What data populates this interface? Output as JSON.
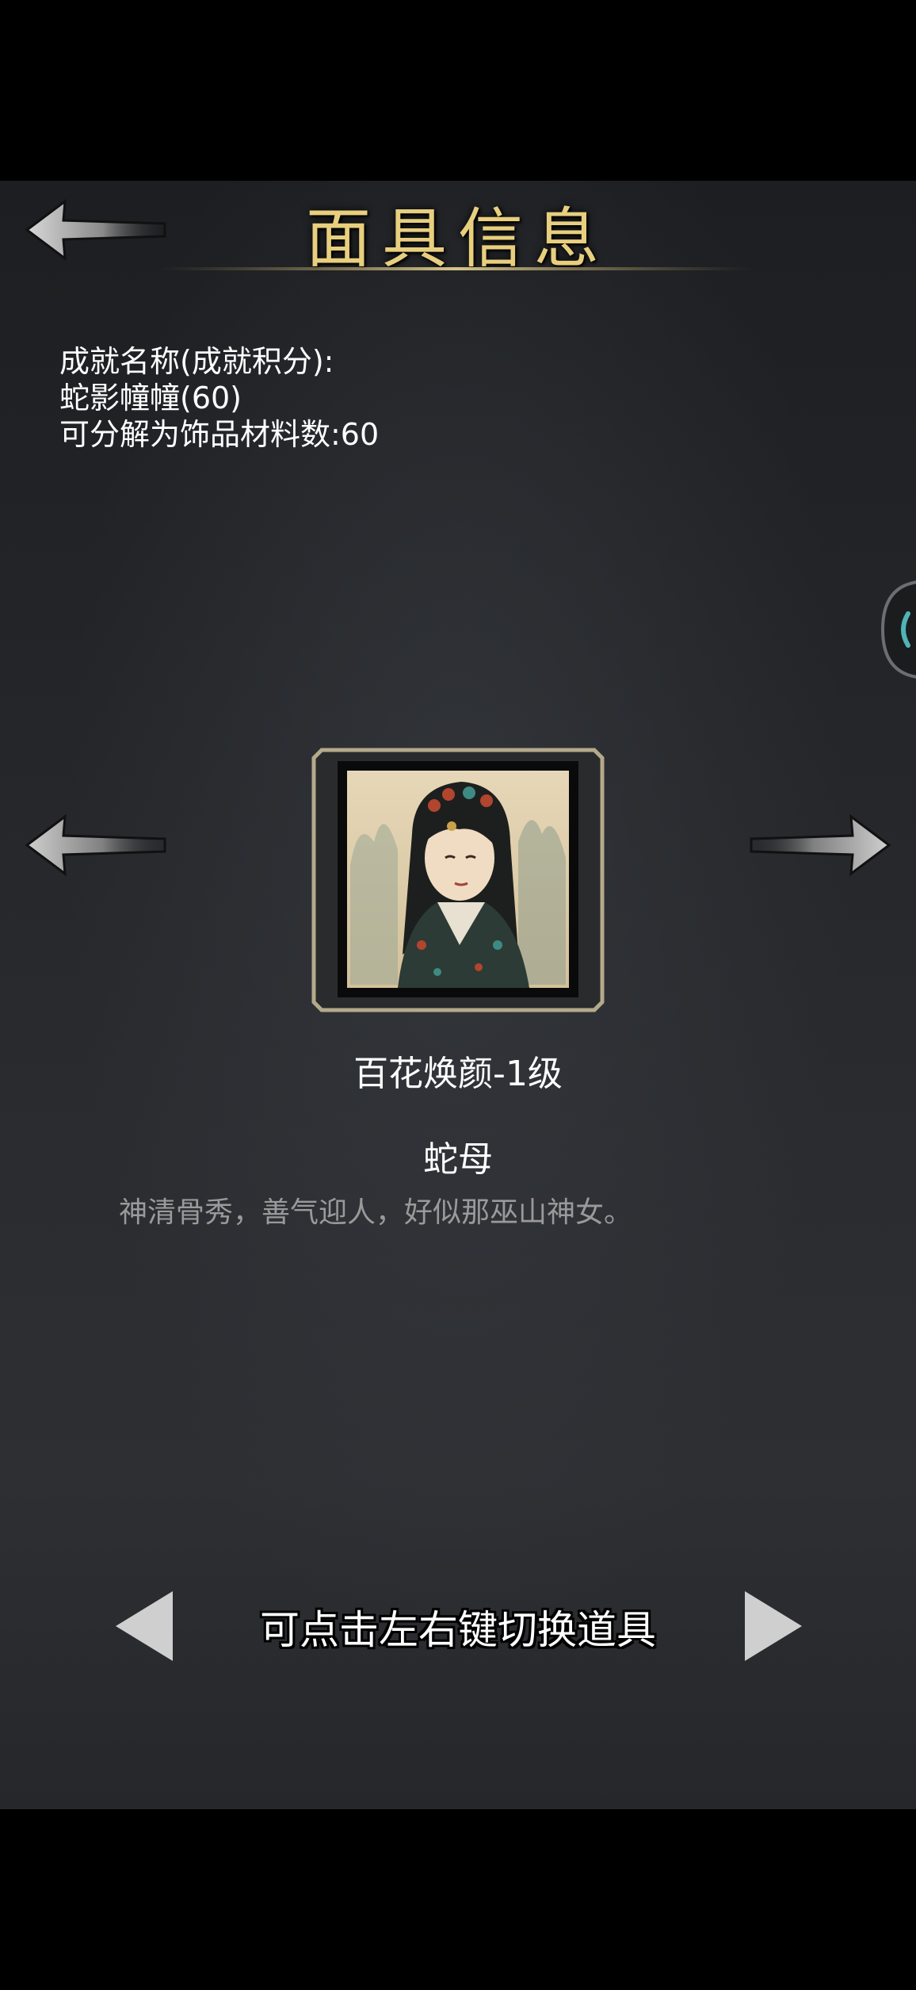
{
  "header": {
    "title": "面具信息"
  },
  "info": {
    "achievement_label": "成就名称(成就积分):",
    "achievement_value": "蛇影幢幢(60)",
    "decompose_text": "可分解为饰品材料数:60"
  },
  "item": {
    "mask_name": "百花焕颜-1级",
    "character_name": "蛇母",
    "description": "神清骨秀，善气迎人，好似那巫山神女。"
  },
  "footer": {
    "hint": "可点击左右键切换道具"
  },
  "colors": {
    "title_gold": "#e8cf7e",
    "frame_gold": "#b4a98a",
    "text_white": "#ffffff",
    "text_gray": "#9a9a9a",
    "side_tab_accent": "#4fb3b8"
  },
  "icons": {
    "back": "back-arrow-icon",
    "prev": "left-arrow-icon",
    "next": "right-arrow-icon",
    "hint_prev": "triangle-left-icon",
    "hint_next": "triangle-right-icon",
    "side_tab": "side-tab-icon"
  }
}
